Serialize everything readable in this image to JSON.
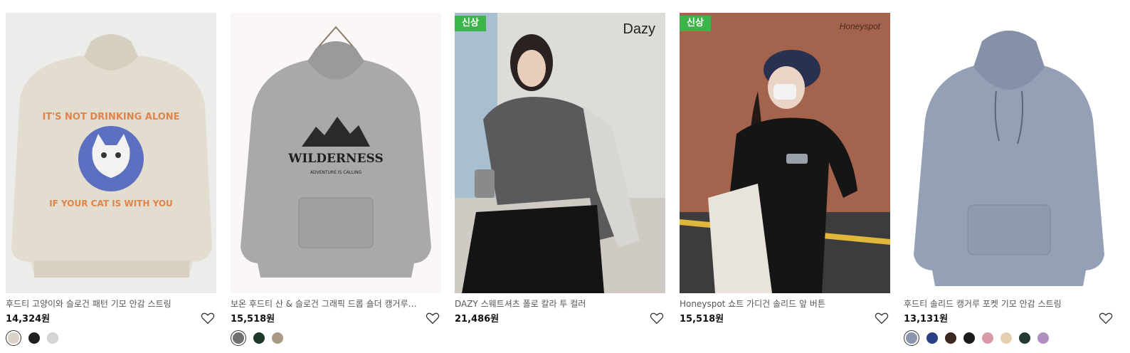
{
  "products": [
    {
      "title": "후드티 고양이와 슬로건 패턴 기모 안감 스트링",
      "price": "14,324원",
      "badge": "",
      "brand_mark": "",
      "image": "beige-hoodie-cat-print",
      "print_text_top": "IT'S NOT DRINKING ALONE",
      "print_text_bottom": "IF YOUR CAT IS WITH YOU",
      "swatches": [
        "#d9d2c6",
        "#1e1e1e",
        "#d6d6d6"
      ]
    },
    {
      "title": "보온 후드티 산 & 슬로건 그래픽 드롭 숄더 캥거루 포...",
      "price": "15,518원",
      "badge": "",
      "brand_mark": "",
      "image": "gray-hoodie-mountain-print",
      "print_text_top": "WILDERNESS",
      "print_text_bottom": "ADVENTURE IS CALLING",
      "swatches": [
        "#6f6f6f",
        "#1f3a2a",
        "#a89984"
      ]
    },
    {
      "title": "DAZY 스웨트셔츠 폴로 칼라 투 컬러",
      "price": "21,486원",
      "badge": "신상",
      "brand_mark": "Dazy",
      "image": "woman-polo-sweatshirt",
      "swatches": []
    },
    {
      "title": "Honeyspot 쇼트 가디건 솔리드 앞 버튼",
      "price": "15,518원",
      "badge": "신상",
      "brand_mark": "Honeyspot",
      "image": "woman-black-cardigan",
      "swatches": []
    },
    {
      "title": "후드티 솔리드 캥거루 포켓 기모 안감 스트링",
      "price": "13,131원",
      "badge": "",
      "brand_mark": "",
      "image": "blue-gray-hoodie",
      "swatches": [
        "#8a96ad",
        "#2b3f86",
        "#3a2820",
        "#1b1b1b",
        "#d89aa8",
        "#e4cfae",
        "#223a30",
        "#b08fc0"
      ]
    }
  ],
  "icons": {
    "wishlist": "heart-outline-icon"
  }
}
